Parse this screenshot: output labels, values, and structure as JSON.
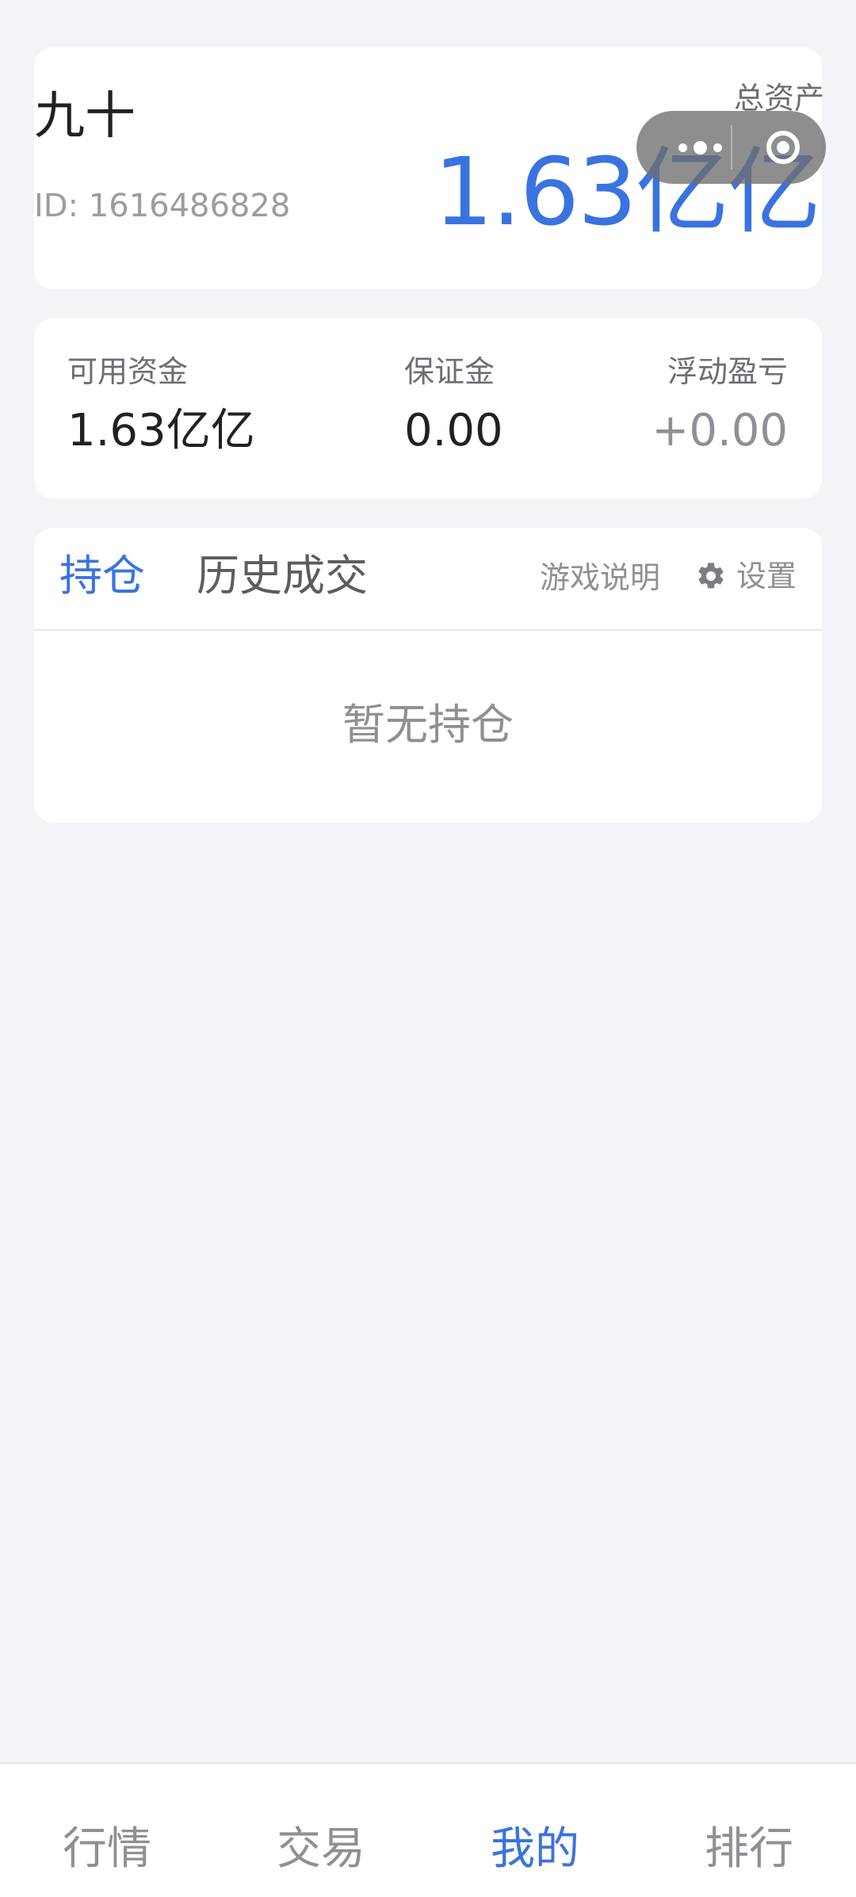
{
  "profile": {
    "username": "九十",
    "user_id": "ID: 1616486828",
    "total_assets_label": "总资产",
    "total_assets_value": "1.63亿亿"
  },
  "stats": {
    "available_funds": {
      "label": "可用资金",
      "value": "1.63亿亿"
    },
    "margin": {
      "label": "保证金",
      "value": "0.00"
    },
    "floating_pnl": {
      "label": "浮动盈亏",
      "value": "+0.00"
    }
  },
  "positions": {
    "tabs": [
      {
        "label": "持仓",
        "active": true
      },
      {
        "label": "历史成交",
        "active": false
      }
    ],
    "guide_label": "游戏说明",
    "settings_label": "设置",
    "empty_text": "暂无持仓"
  },
  "bottom_nav": {
    "items": [
      {
        "label": "行情",
        "active": false
      },
      {
        "label": "交易",
        "active": false
      },
      {
        "label": "我的",
        "active": true
      },
      {
        "label": "排行",
        "active": false
      }
    ]
  },
  "colors": {
    "accent": "#3a73e0",
    "background": "#f3f4f8",
    "card": "#ffffff"
  },
  "icons": {
    "settings": "gear-icon",
    "capsule_more": "more-dots-icon",
    "capsule_close": "close-target-icon"
  }
}
